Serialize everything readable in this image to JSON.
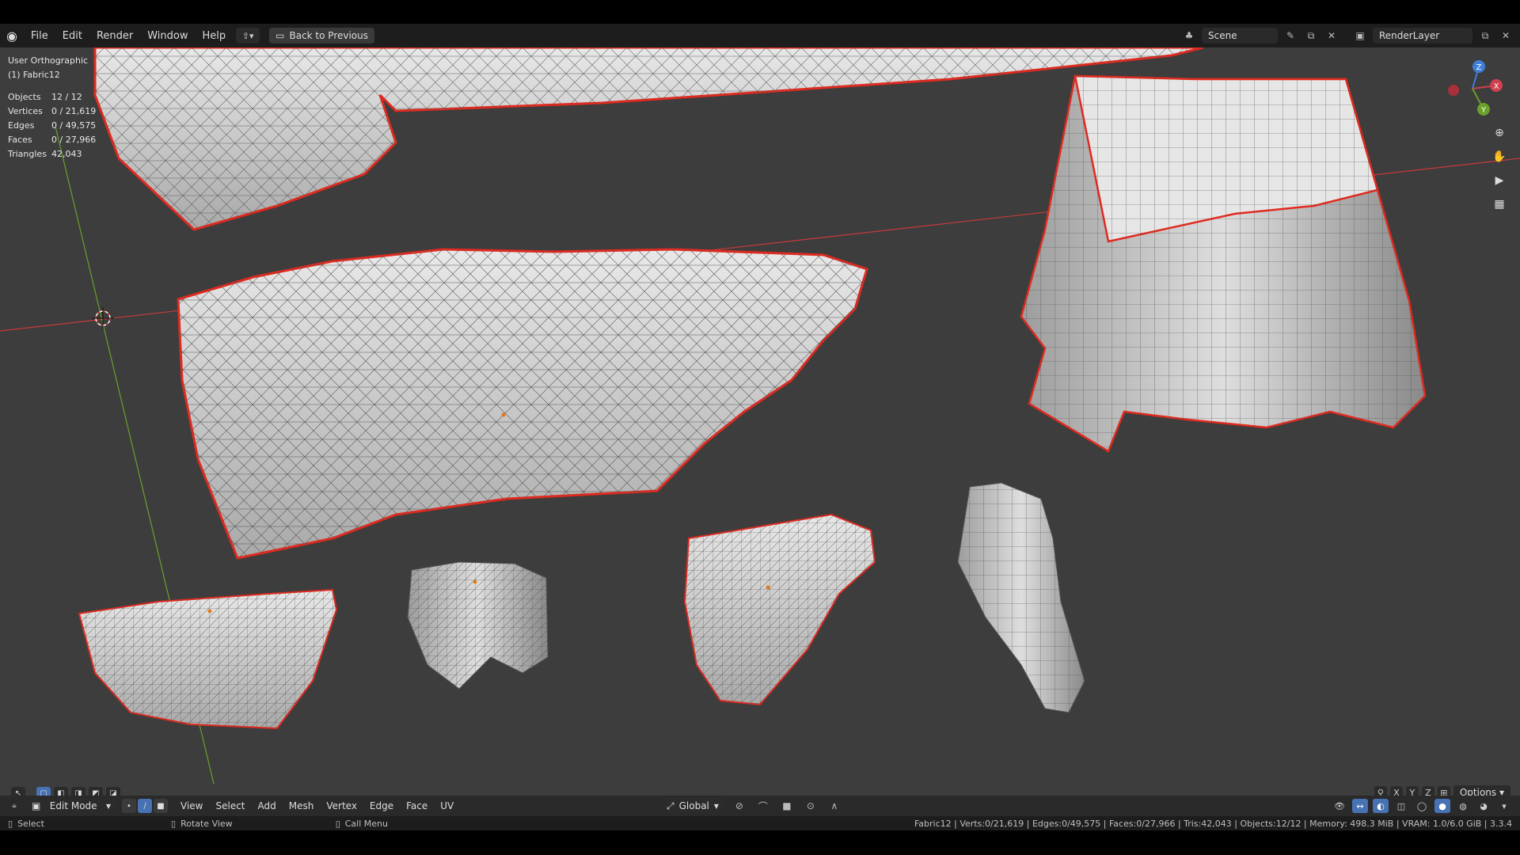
{
  "topbar": {
    "menu": [
      "File",
      "Edit",
      "Render",
      "Window",
      "Help"
    ],
    "back_button": "Back to Previous",
    "scene": "Scene",
    "render_layer": "RenderLayer"
  },
  "viewport": {
    "view_name": "User Orthographic",
    "object_name": "(1) Fabric12",
    "stats": [
      {
        "k": "Objects",
        "v": "12 / 12"
      },
      {
        "k": "Vertices",
        "v": "0 / 21,619"
      },
      {
        "k": "Edges",
        "v": "0 / 49,575"
      },
      {
        "k": "Faces",
        "v": "0 / 27,966"
      },
      {
        "k": "Triangles",
        "v": "42,043"
      }
    ],
    "gizmo": {
      "z": "Z",
      "x": "X",
      "y": "Y"
    },
    "axis_buttons": [
      "X",
      "Y",
      "Z"
    ],
    "options_label": "Options"
  },
  "header3d": {
    "mode": "Edit Mode",
    "menu": [
      "View",
      "Select",
      "Add",
      "Mesh",
      "Vertex",
      "Edge",
      "Face",
      "UV"
    ],
    "orientation": "Global"
  },
  "statusbar": {
    "select": "Select",
    "rotate": "Rotate View",
    "call_menu": "Call Menu",
    "info": "Fabric12 | Verts:0/21,619 | Edges:0/49,575 | Faces:0/27,966 | Tris:42,043 | Objects:12/12 | Memory: 498.3 MiB | VRAM: 1.0/6.0 GiB | 3.3.4"
  },
  "colors": {
    "accent": "#4772b3",
    "viewport_bg": "#3d3d3d",
    "header_bg": "#2a2a2a",
    "boundary_red": "#e02a1f",
    "axis_red": "#c83a3a",
    "axis_green": "#6aa02a"
  }
}
